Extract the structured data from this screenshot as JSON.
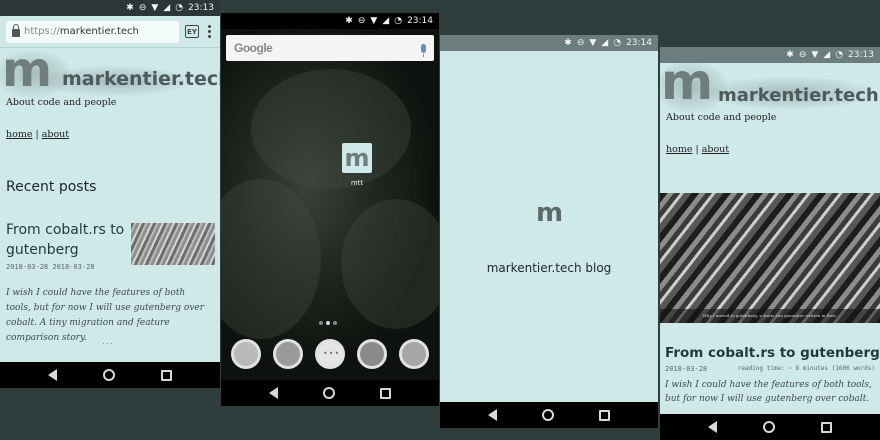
{
  "status_time_1": "23:13",
  "status_time_2": "23:14",
  "status_time_3": "23:14",
  "status_time_4": "23:13",
  "browser": {
    "url_scheme": "https://",
    "url_host": "markentier.tech",
    "tabs_count": "EY"
  },
  "site": {
    "logo_letter": "m",
    "title": "markentier.tech",
    "tagline": "About code and people",
    "nav": {
      "home": "home",
      "separator": " | ",
      "about": "about"
    }
  },
  "recent": {
    "heading": "Recent posts",
    "post_title": "From cobalt.rs to gutenberg",
    "post_date": "2018-03-28 2018-03-28",
    "post_excerpt": "I wish I could have the features of both tools, but for now I will use gutenberg over cobalt. A tiny migration and feature comparison story.",
    "more": "..."
  },
  "homescreen": {
    "search_logo": "Google",
    "app_icon_letter": "m",
    "app_label": "mtt"
  },
  "splash": {
    "logo_letter": "m",
    "title": "markentier.tech blog"
  },
  "post": {
    "hero_caption": "Why I moved to gutenberg, a static site generator written in Rust.",
    "title": "From cobalt.rs to gutenberg",
    "date": "2018-03-28",
    "reading_time": "reading time: ~ 8 minutes (1606 words)",
    "excerpt": "I wish I could have the features of both tools, but for now I will use gutenberg over cobalt. A tiny"
  },
  "colors": {
    "page_bg": "#cfe9e9",
    "frame_bg": "#2f3d3d",
    "logo_gray": "#6f7d7d"
  }
}
